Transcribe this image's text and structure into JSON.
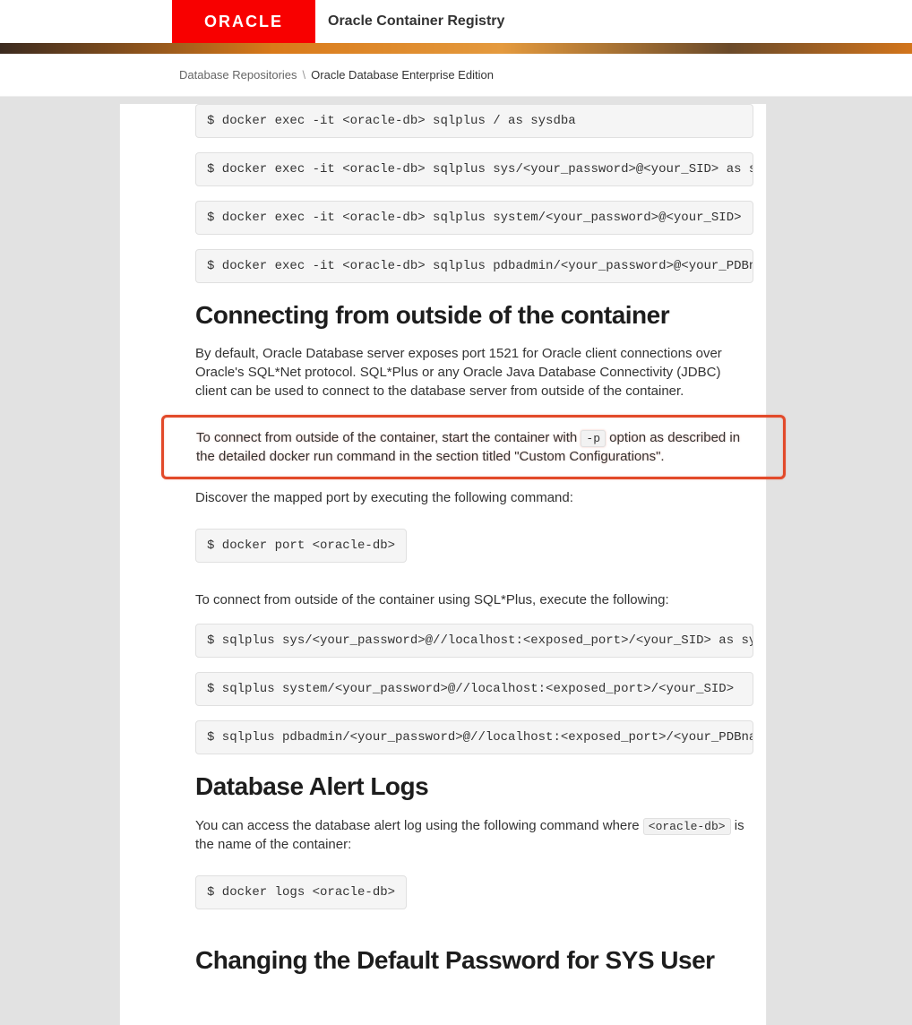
{
  "header": {
    "logo_text": "ORACLE",
    "product": "Oracle Container Registry"
  },
  "breadcrumb": {
    "parent": "Database Repositories",
    "sep": "\\",
    "current": "Oracle Database Enterprise Edition"
  },
  "intro_cmds": [
    "$ docker exec -it <oracle-db> sqlplus / as sysdba",
    "$ docker exec -it <oracle-db> sqlplus sys/<your_password>@<your_SID> as s",
    "$ docker exec -it <oracle-db> sqlplus system/<your_password>@<your_SID>",
    "$ docker exec -it <oracle-db> sqlplus pdbadmin/<your_password>@<your_PDBn"
  ],
  "connect": {
    "heading": "Connecting from outside of the container",
    "para1": "By default, Oracle Database server exposes port 1521 for Oracle client connections over Oracle's SQL*Net protocol. SQL*Plus or any Oracle Java Database Connectivity (JDBC) client can be used to connect to the database server from outside of the container.",
    "hl_pre": "To connect from outside of the container, start the container with ",
    "hl_code": "-p",
    "hl_post": " option as described in the detailed docker run command in the section titled \"Custom Configurations\".",
    "para3": "Discover the mapped port by executing the following command:",
    "cmd_port": "$ docker port <oracle-db>",
    "para4": "To connect from outside of the container using SQL*Plus, execute the following:",
    "cmds_outside": [
      "$ sqlplus sys/<your_password>@//localhost:<exposed_port>/<your_SID> as sy",
      "$ sqlplus system/<your_password>@//localhost:<exposed_port>/<your_SID>",
      "$ sqlplus pdbadmin/<your_password>@//localhost:<exposed_port>/<your_PDBna"
    ]
  },
  "alert": {
    "heading": "Database Alert Logs",
    "para_pre": "You can access the database alert log using the following command where ",
    "code": "<oracle-db>",
    "para_post": " is the name of the container:",
    "cmd": "$ docker logs <oracle-db>"
  },
  "passwd": {
    "heading": "Changing the Default Password for SYS User"
  }
}
